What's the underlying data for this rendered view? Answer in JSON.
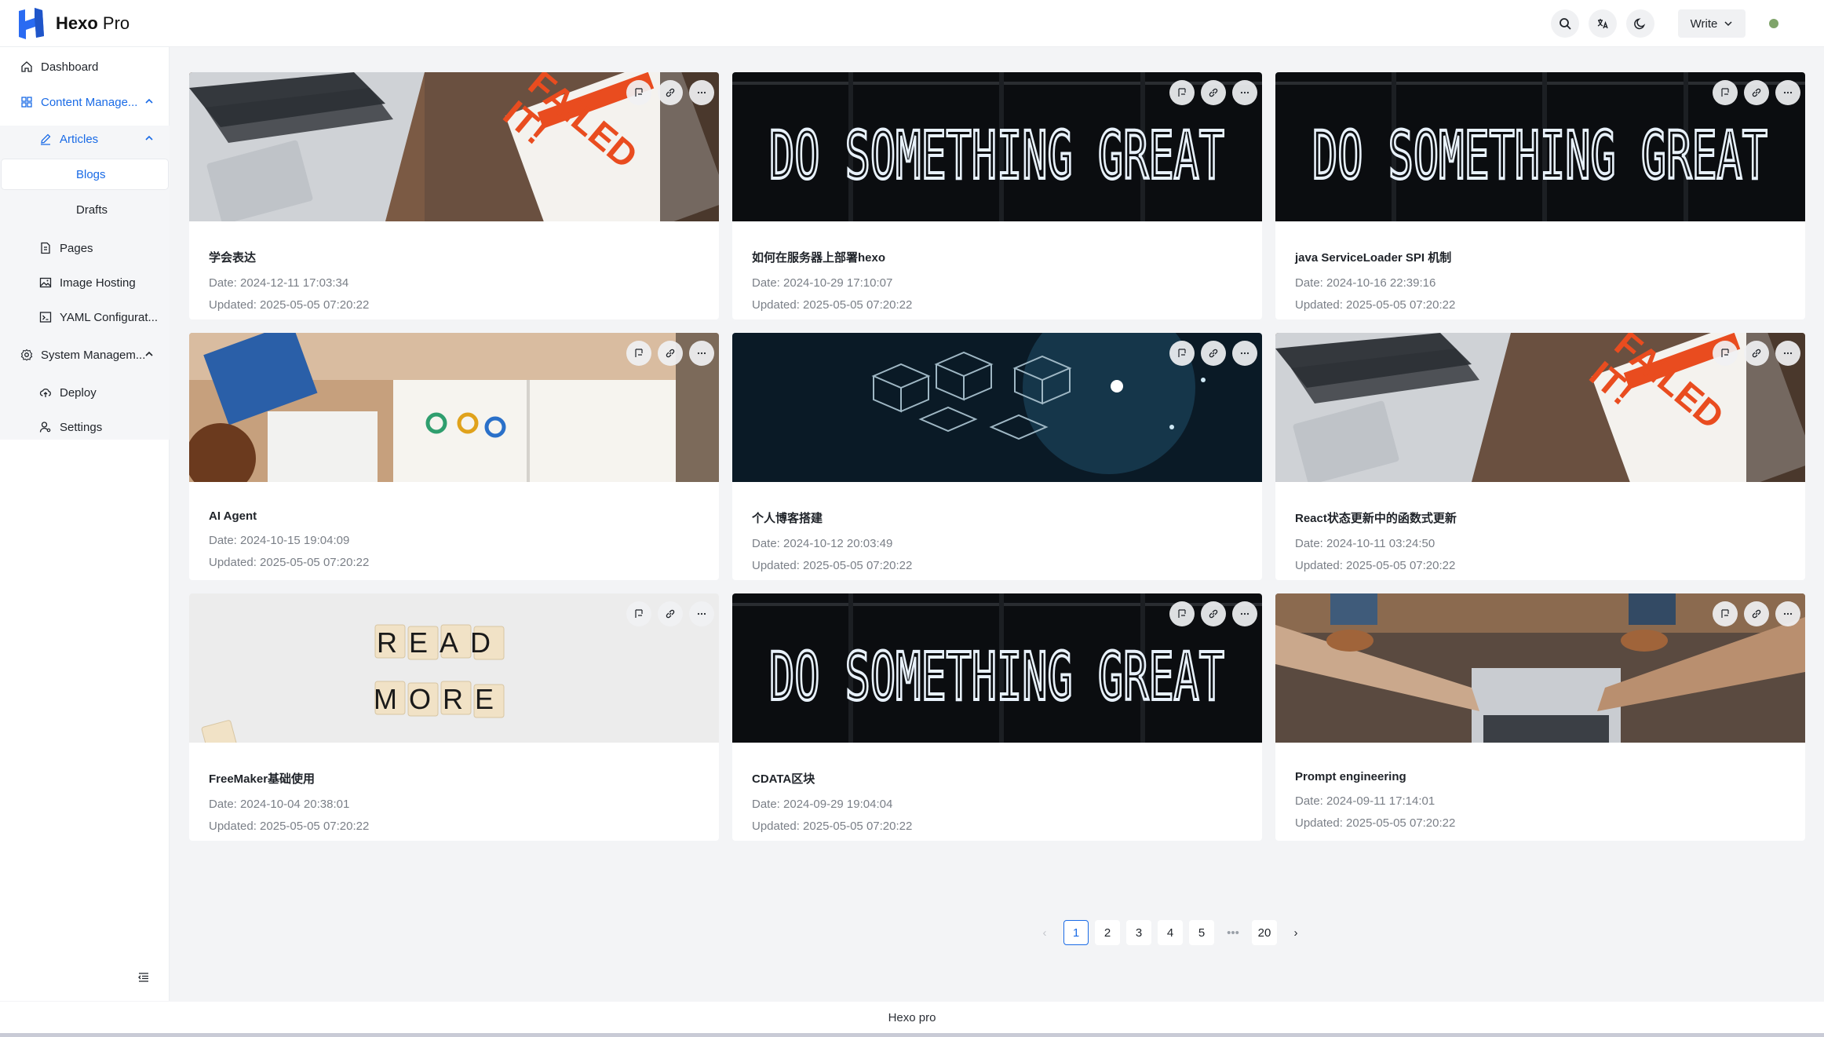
{
  "app": {
    "brand": "Hexo",
    "brand_suffix": "Pro"
  },
  "header": {
    "write_label": "Write",
    "icons": [
      "search-icon",
      "translate-icon",
      "moon-icon",
      "chevron-down-icon"
    ]
  },
  "sidebar": {
    "items": [
      {
        "label": "Dashboard",
        "icon": "home-icon"
      },
      {
        "label": "Content Manage...",
        "icon": "grid-icon"
      },
      {
        "label": "Articles",
        "icon": "edit-icon"
      },
      {
        "label": "Blogs"
      },
      {
        "label": "Drafts"
      },
      {
        "label": "Pages",
        "icon": "file-icon"
      },
      {
        "label": "Image Hosting",
        "icon": "image-icon"
      },
      {
        "label": "YAML Configurat...",
        "icon": "terminal-icon"
      },
      {
        "label": "System Managem...",
        "icon": "gear-icon"
      },
      {
        "label": "Deploy",
        "icon": "cloud-icon"
      },
      {
        "label": "Settings",
        "icon": "user-settings-icon"
      }
    ],
    "accent": "#1a6be6"
  },
  "cards": [
    {
      "title": "学会表达",
      "date": "Date: 2024-12-11 17:03:34",
      "updated": "Updated: 2025-05-05 07:20:22",
      "cover": "laptop-book"
    },
    {
      "title": "如何在服务器上部署hexo",
      "date": "Date: 2024-10-29 17:10:07",
      "updated": "Updated: 2025-05-05 07:20:22",
      "cover": "neon-sign"
    },
    {
      "title": "java ServiceLoader SPI 机制",
      "date": "Date: 2024-10-16 22:39:16",
      "updated": "Updated: 2025-05-05 07:20:22",
      "cover": "neon-sign"
    },
    {
      "title": "AI Agent",
      "date": "Date: 2024-10-15 19:04:09",
      "updated": "Updated: 2025-05-05 07:20:22",
      "cover": "desk-book"
    },
    {
      "title": "个人博客搭建",
      "date": "Date: 2024-10-12 20:03:49",
      "updated": "Updated: 2025-05-05 07:20:22",
      "cover": "cubes"
    },
    {
      "title": "React状态更新中的函数式更新",
      "date": "Date: 2024-10-11 03:24:50",
      "updated": "Updated: 2025-05-05 07:20:22",
      "cover": "laptop-book"
    },
    {
      "title": "FreeMaker基础使用",
      "date": "Date: 2024-10-04 20:38:01",
      "updated": "Updated: 2025-05-05 07:20:22",
      "cover": "read-more"
    },
    {
      "title": "CDATA区块",
      "date": "Date: 2024-09-29 19:04:04",
      "updated": "Updated: 2025-05-05 07:20:22",
      "cover": "neon-sign"
    },
    {
      "title": "Prompt engineering",
      "date": "Date: 2024-09-11 17:14:01",
      "updated": "Updated: 2025-05-05 07:20:22",
      "cover": "hands-laptop"
    }
  ],
  "covers": {
    "neon_text": "DO SOMETHING GREAT",
    "book_text_1": "FAILED",
    "book_text_2": "IT!",
    "read_text": "READ",
    "more_text": "MORE"
  },
  "pagination": {
    "pages": [
      "1",
      "2",
      "3",
      "4",
      "5",
      "•••",
      "20"
    ],
    "current": "1",
    "prev": "‹",
    "next": "›"
  },
  "footer": {
    "text": "Hexo pro"
  }
}
